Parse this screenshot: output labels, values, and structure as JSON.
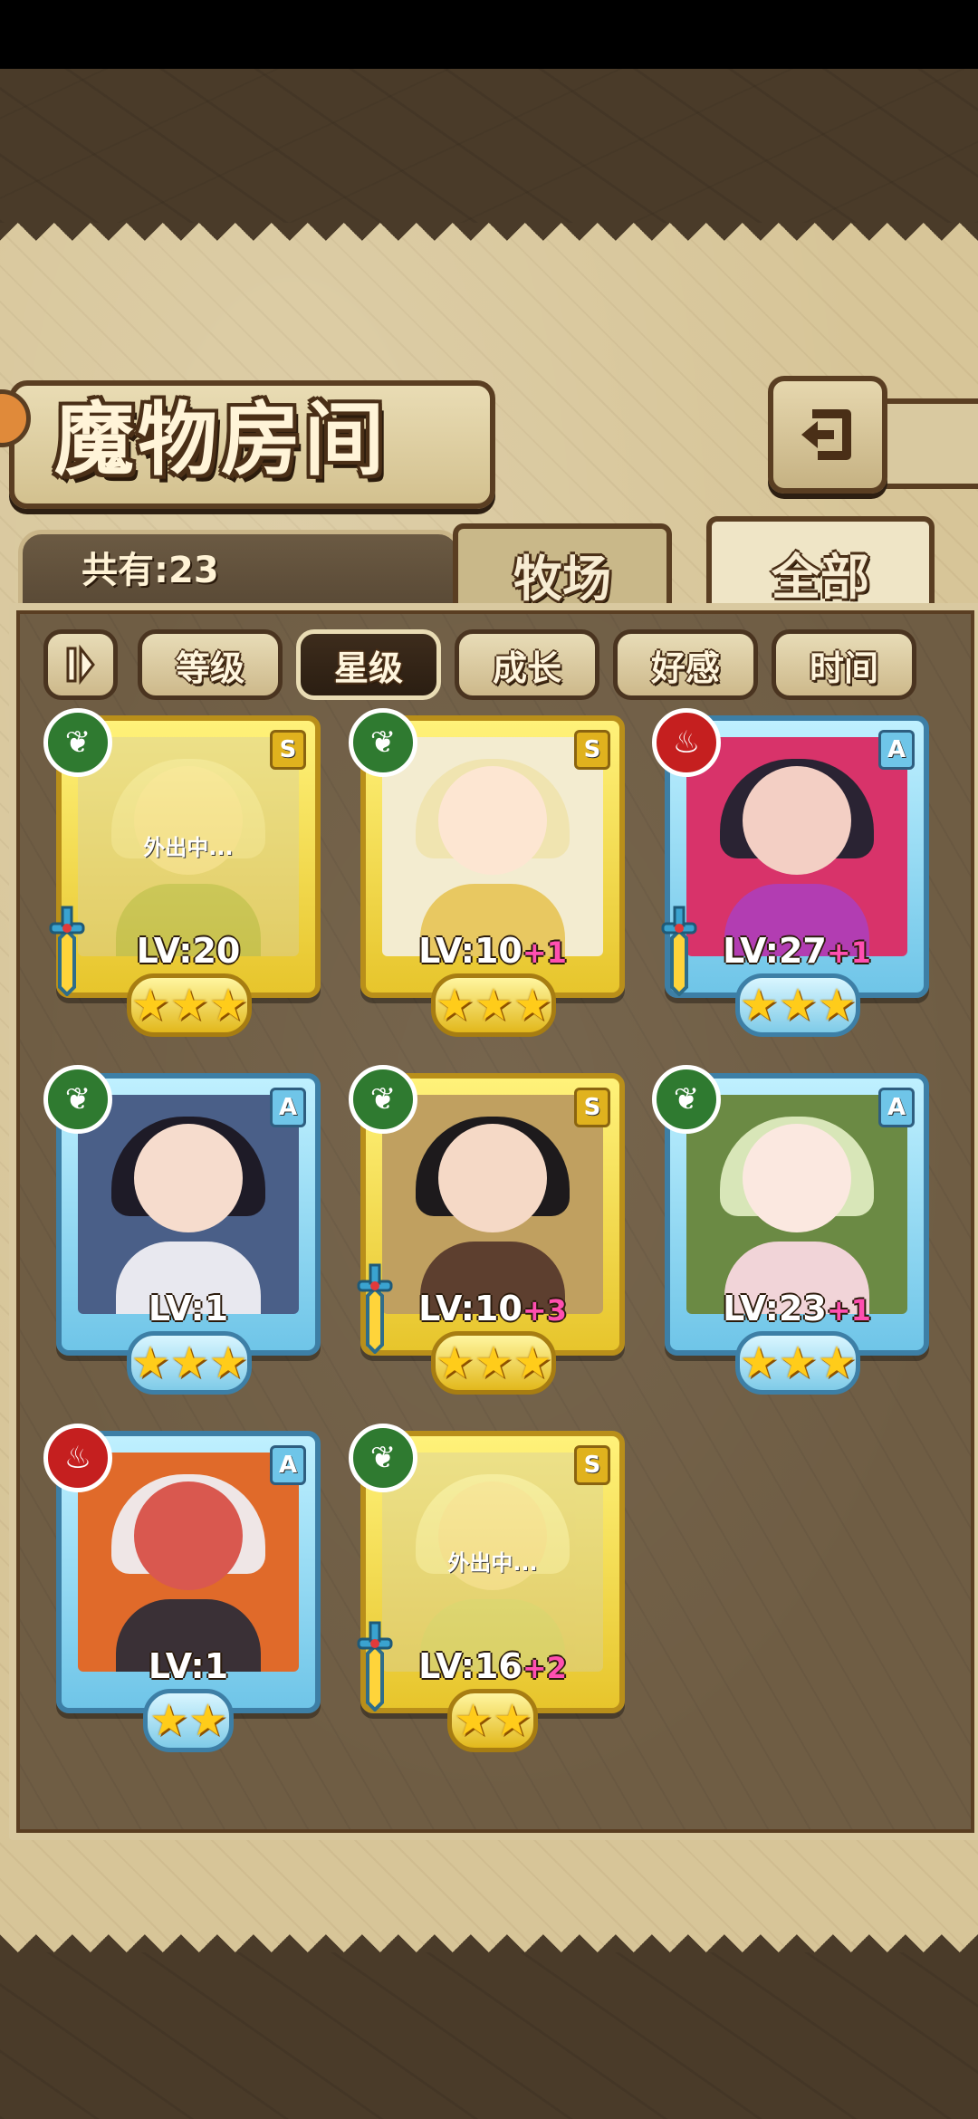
{
  "title": "魔物房间",
  "count_label": "共有:23",
  "tabs": [
    {
      "label": "牧场"
    },
    {
      "label": "全部"
    }
  ],
  "sort_buttons": [
    {
      "label": "等级"
    },
    {
      "label": "星级"
    },
    {
      "label": "成长"
    },
    {
      "label": "好感"
    },
    {
      "label": "时间"
    }
  ],
  "active_sort": "星级",
  "status_away": "外出中...",
  "monsters": [
    {
      "grade": "S",
      "element": "leaf-icon",
      "level": "LV:20",
      "plus": "",
      "stars": 3,
      "away": true,
      "weapon": true
    },
    {
      "grade": "S",
      "element": "leaf-icon",
      "level": "LV:10",
      "plus": "+1",
      "stars": 3,
      "away": false,
      "weapon": false
    },
    {
      "grade": "A",
      "element": "fire-icon",
      "level": "LV:27",
      "plus": "+1",
      "stars": 3,
      "away": false,
      "weapon": true
    },
    {
      "grade": "A",
      "element": "leaf-icon",
      "level": "LV:1",
      "plus": "",
      "stars": 3,
      "away": false,
      "weapon": false
    },
    {
      "grade": "S",
      "element": "leaf-icon",
      "level": "LV:10",
      "plus": "+3",
      "stars": 3,
      "away": false,
      "weapon": true
    },
    {
      "grade": "A",
      "element": "leaf-icon",
      "level": "LV:23",
      "plus": "+1",
      "stars": 3,
      "away": false,
      "weapon": false
    },
    {
      "grade": "A",
      "element": "fire-icon",
      "level": "LV:1",
      "plus": "",
      "stars": 2,
      "away": false,
      "weapon": false
    },
    {
      "grade": "S",
      "element": "leaf-icon",
      "level": "LV:16",
      "plus": "+2",
      "stars": 2,
      "away": true,
      "weapon": true
    }
  ],
  "colors": {
    "s_frame": "#e7c52c",
    "a_frame": "#6fc5e8",
    "leaf": "#2f7a30",
    "fire": "#c51f1f",
    "plus_text": "#ff4fb0"
  }
}
